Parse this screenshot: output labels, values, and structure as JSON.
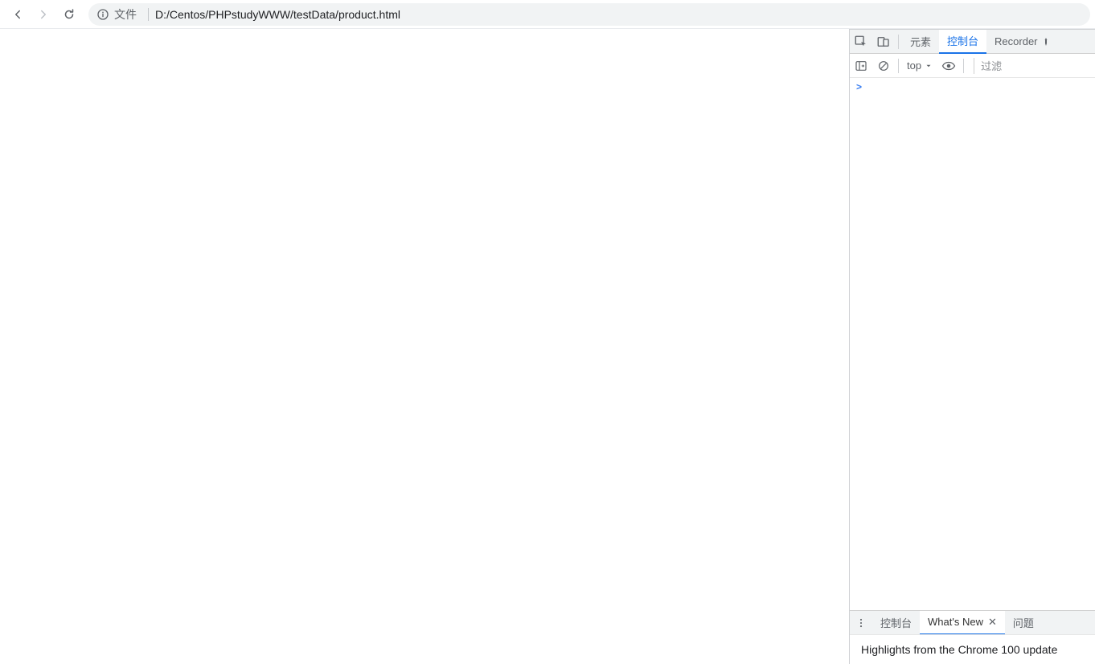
{
  "browser": {
    "file_label": "文件",
    "url": "D:/Centos/PHPstudyWWW/testData/product.html"
  },
  "devtools": {
    "tabs": {
      "elements": "元素",
      "console": "控制台",
      "recorder": "Recorder"
    },
    "console_toolbar": {
      "context": "top",
      "filter_placeholder": "过滤"
    },
    "prompt": ">",
    "drawer": {
      "more": "⋮",
      "console": "控制台",
      "whats_new": "What's New",
      "issues": "问题",
      "highlights": "Highlights from the Chrome 100 update"
    }
  }
}
